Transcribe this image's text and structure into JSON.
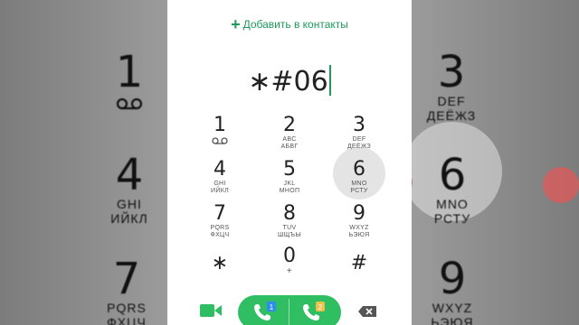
{
  "header": {
    "add_contact_label": "Добавить в контакты"
  },
  "dialer": {
    "number": "∗#06"
  },
  "keys": [
    {
      "digit": "1",
      "letters": "",
      "letters2": ""
    },
    {
      "digit": "2",
      "letters": "ABC",
      "letters2": "АБВГ"
    },
    {
      "digit": "3",
      "letters": "DEF",
      "letters2": "ДЕЁЖЗ"
    },
    {
      "digit": "4",
      "letters": "GHI",
      "letters2": "ИЙКЛ"
    },
    {
      "digit": "5",
      "letters": "JKL",
      "letters2": "МНОП"
    },
    {
      "digit": "6",
      "letters": "MNO",
      "letters2": "РСТУ"
    },
    {
      "digit": "7",
      "letters": "PQRS",
      "letters2": "ФХЦЧ"
    },
    {
      "digit": "8",
      "letters": "TUV",
      "letters2": "ШЩЪЫ"
    },
    {
      "digit": "9",
      "letters": "WXYZ",
      "letters2": "ЬЭЮЯ"
    },
    {
      "digit": "∗",
      "letters": "",
      "letters2": ""
    },
    {
      "digit": "0",
      "letters": "+",
      "letters2": ""
    },
    {
      "digit": "#",
      "letters": "",
      "letters2": ""
    }
  ],
  "background_keys": {
    "left": [
      {
        "digit": "1",
        "letters": ""
      },
      {
        "digit": "4",
        "letters": "GHI",
        "letters2": "ИЙКЛ"
      },
      {
        "digit": "7",
        "letters": "PQRS",
        "letters2": "ФХЦЧ"
      }
    ],
    "right": [
      {
        "digit": "3",
        "letters": "DEF",
        "letters2": "ДЕЁЖЗ"
      },
      {
        "digit": "6",
        "letters": "MNO",
        "letters2": "РСТУ"
      },
      {
        "digit": "9",
        "letters": "WXYZ",
        "letters2": "ЬЭЮЯ"
      }
    ]
  },
  "sim_badges": {
    "sim1": "1",
    "sim2": "2"
  },
  "icons": {
    "add": "plus-icon",
    "voicemail": "voicemail-icon",
    "video_call": "video-camera-icon",
    "call_sim1": "phone-sim1-icon",
    "call_sim2": "phone-sim2-icon",
    "backspace": "backspace-icon"
  },
  "colors": {
    "accent": "#1e9a5a",
    "call_button": "#2fbf62",
    "sim1_badge": "#2d8cf0",
    "sim2_badge": "#f0c14b",
    "pressed_key": "#e4e4e4"
  }
}
